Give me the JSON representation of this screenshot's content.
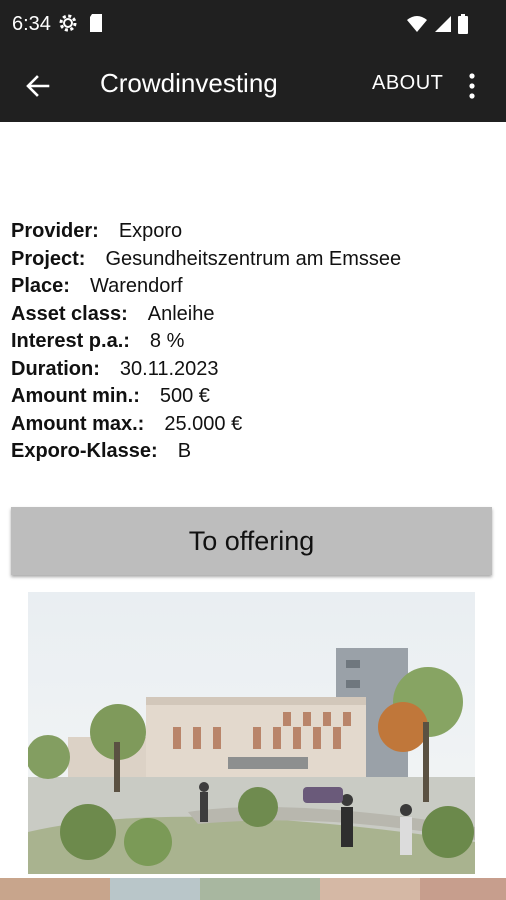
{
  "status_bar": {
    "time": "6:34"
  },
  "app_bar": {
    "title": "Crowdinvesting",
    "about_label": "ABOUT"
  },
  "details": [
    {
      "label": "Provider:",
      "value": "Exporo"
    },
    {
      "label": "Project:",
      "value": "Gesundheitszentrum am Emssee"
    },
    {
      "label": "Place:",
      "value": "Warendorf"
    },
    {
      "label": "Asset class:",
      "value": "Anleihe"
    },
    {
      "label": "Interest p.a.:",
      "value": "8 %"
    },
    {
      "label": "Duration:",
      "value": "30.11.2023"
    },
    {
      "label": "Amount min.:",
      "value": "500 €"
    },
    {
      "label": "Amount max.:",
      "value": "25.000 €"
    },
    {
      "label": "Exporo-Klasse:",
      "value": "B"
    }
  ],
  "cta": {
    "label": "To offering"
  },
  "icons": {
    "status": [
      "settings-gear-icon",
      "sd-card-icon",
      "wifi-icon",
      "cell-signal-icon",
      "battery-icon"
    ],
    "app_bar": [
      "back-arrow-icon",
      "more-vert-icon"
    ]
  },
  "colors": {
    "app_bar_bg": "#202020",
    "button_bg": "#bdbdbd"
  }
}
